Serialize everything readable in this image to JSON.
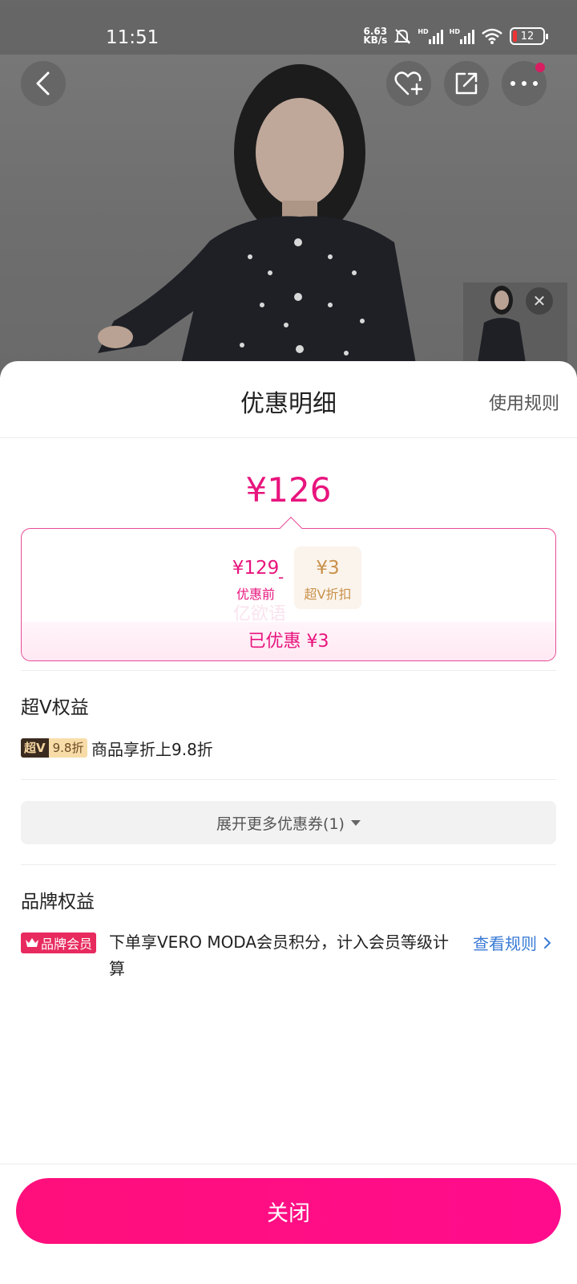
{
  "status_bar": {
    "time": "11:51",
    "net_speed_value": "6.63",
    "net_speed_unit": "KB/s",
    "hd_label": "HD",
    "battery_level": "12"
  },
  "top_nav": {
    "icons": [
      "back-icon",
      "heart-add-icon",
      "share-icon",
      "more-icon"
    ]
  },
  "sheet": {
    "title": "优惠明细",
    "rules_link": "使用规则",
    "total_price": "¥126",
    "calc": {
      "original_amount": "¥129",
      "original_label": "优惠前",
      "operator": "-",
      "discount_amount": "¥3",
      "discount_label": "超V折扣",
      "saved_text": "已优惠 ¥3",
      "watermark": "亿欲语"
    },
    "chao_v": {
      "title": "超V权益",
      "badge_left": "超V",
      "badge_right": "9.8折",
      "description": "商品享折上9.8折"
    },
    "expand_button": "展开更多优惠券(1)",
    "brand": {
      "title": "品牌权益",
      "badge": "品牌会员",
      "description": "下单享VERO MODA会员积分，计入会员等级计算",
      "link": "查看规则"
    },
    "close_button": "关闭"
  },
  "colors": {
    "accent": "#e8147d",
    "button_gradient_start": "#ff0f7b",
    "link_blue": "#3a7bd5",
    "gold": "#c9914b"
  }
}
